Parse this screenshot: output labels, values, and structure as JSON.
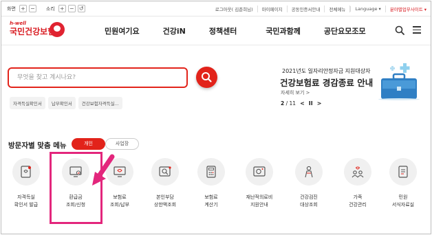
{
  "utility_bar": {
    "screen_label": "화면",
    "sound_label": "소리",
    "plus": "+",
    "minus": "−",
    "reset": "↺",
    "links": [
      "로그아웃( 김준희님)",
      "마이페이지",
      "공동인증서안내",
      "전체메뉴"
    ],
    "language": "Language ▾",
    "branch": "분야별업무사이트 ▾"
  },
  "header": {
    "logo_top": "h-well",
    "logo_main": "국민건강보험",
    "nav": [
      "민원여기요",
      "건강iN",
      "정책센터",
      "국민과함께",
      "공단요모조모"
    ]
  },
  "search": {
    "placeholder": "무엇을 찾고 계시나요?",
    "tags": [
      "자격득실확인서",
      "납부확인서",
      "건강보험자격득실..."
    ]
  },
  "banner": {
    "sub": "2021년도 일자리안정자금 지원대상자",
    "title": "건강보험료 경감종료 안내",
    "more": "자세히 보기 >",
    "page_current": "2",
    "page_sep": " / ",
    "page_total": "11",
    "prev": "<",
    "pause": "II",
    "next": ">"
  },
  "menu": {
    "title": "방문자별 맞춤 메뉴",
    "seg_personal": "개인",
    "seg_business": "사업장",
    "items": [
      {
        "l1": "자격득실",
        "l2": "확인서 발급",
        "icon": "certificate-icon"
      },
      {
        "l1": "환급금",
        "l2": "조회/신청",
        "icon": "refund-monitor-icon"
      },
      {
        "l1": "보험료",
        "l2": "조회/납부",
        "icon": "premium-payment-icon"
      },
      {
        "l1": "본인부담",
        "l2": "상한액조회",
        "icon": "copay-limit-icon"
      },
      {
        "l1": "보험료",
        "l2": "계산기",
        "icon": "calculator-icon"
      },
      {
        "l1": "재난적의료비",
        "l2": "지원안내",
        "icon": "medical-support-icon"
      },
      {
        "l1": "건강검진",
        "l2": "대상조회",
        "icon": "checkup-icon"
      },
      {
        "l1": "가족",
        "l2": "건강관리",
        "icon": "family-health-icon"
      },
      {
        "l1": "민원",
        "l2": "서식자료실",
        "icon": "forms-icon"
      }
    ]
  },
  "colors": {
    "brand_red": "#e2231a",
    "highlight_pink": "#e3267c",
    "icon_bg": "#f0f0f0"
  }
}
